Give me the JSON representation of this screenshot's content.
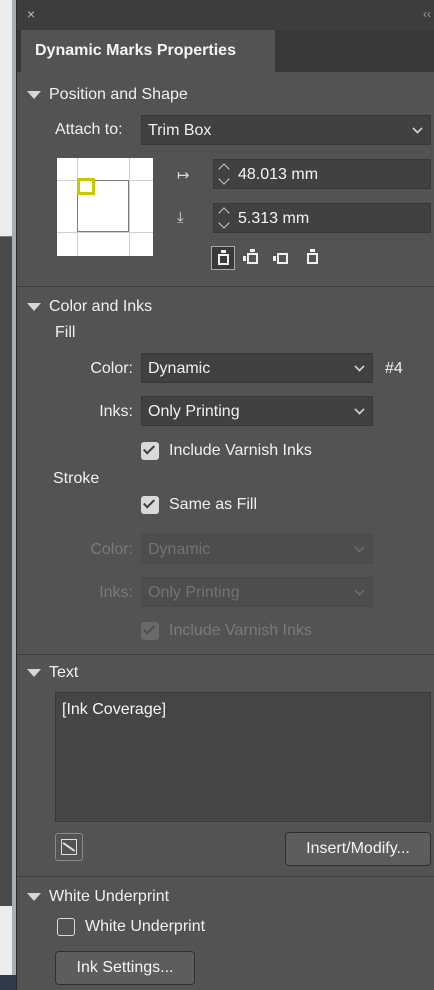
{
  "panel": {
    "close_glyph": "×",
    "collapse_glyph": "‹‹",
    "tab_title": "Dynamic Marks Properties"
  },
  "position_shape": {
    "header": "Position and Shape",
    "attach_label": "Attach to:",
    "attach_value": "Trim Box",
    "x_offset_icon": "horizontal-offset-icon",
    "x_value": "48.013 mm",
    "y_offset_icon": "vertical-offset-icon",
    "y_value": "5.313 mm",
    "anchor_icons": [
      "anchor-top-icon",
      "anchor-all-sides-icon",
      "anchor-left-right-icon",
      "anchor-top-bottom-icon"
    ]
  },
  "color_inks": {
    "header": "Color and Inks",
    "fill_label": "Fill",
    "fill_color_label": "Color:",
    "fill_color_value": "Dynamic",
    "fill_color_number": "#4",
    "fill_inks_label": "Inks:",
    "fill_inks_value": "Only Printing",
    "fill_include_varnish_label": "Include Varnish Inks",
    "fill_include_varnish_checked": true,
    "stroke_label": "Stroke",
    "same_as_fill_label": "Same as Fill",
    "same_as_fill_checked": true,
    "stroke_color_label": "Color:",
    "stroke_color_value": "Dynamic",
    "stroke_inks_label": "Inks:",
    "stroke_inks_value": "Only Printing",
    "stroke_include_varnish_label": "Include Varnish Inks",
    "stroke_include_varnish_checked": true
  },
  "text_section": {
    "header": "Text",
    "content": "[Ink Coverage]",
    "insert_button": "Insert/Modify..."
  },
  "white_underprint": {
    "header": "White Underprint",
    "checkbox_label": "White Underprint",
    "checked": false,
    "ink_settings_button": "Ink Settings..."
  },
  "colors": {
    "panel_bg": "#535353",
    "field_bg": "#414141",
    "marker_yellow": "#c9c900"
  }
}
